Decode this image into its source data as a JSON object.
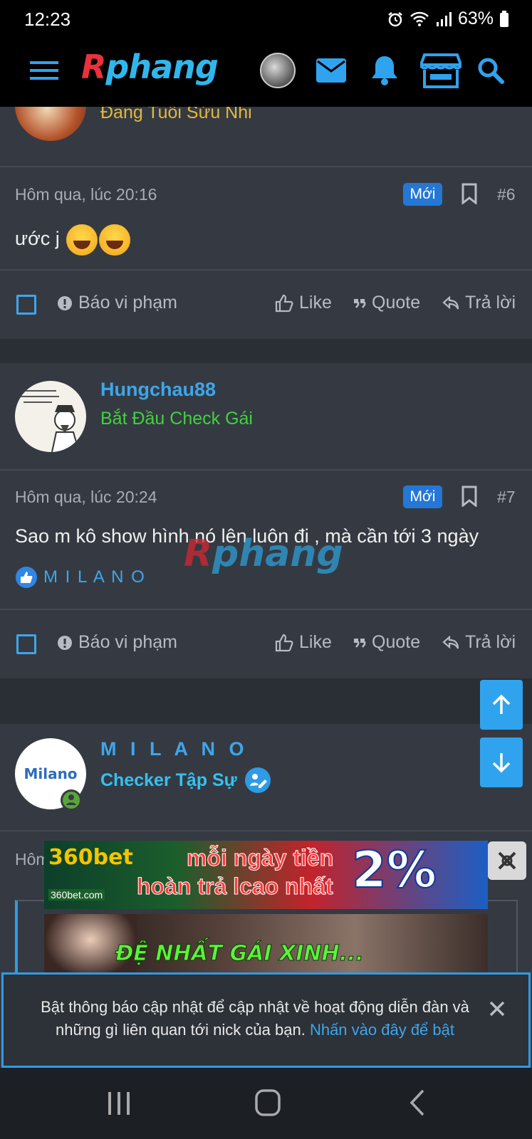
{
  "status": {
    "time": "12:23",
    "battery": "63%"
  },
  "header": {
    "logo_part1": "R",
    "logo_part2": "phang",
    "icons": [
      "menu-icon",
      "avatar",
      "mail-icon",
      "bell-icon",
      "store-icon",
      "search-icon"
    ]
  },
  "post5": {
    "usertitle": "Đang Tuổi Sửu Nhi"
  },
  "post6": {
    "time": "Hôm qua, lúc 20:16",
    "badge": "Mới",
    "number": "#6",
    "text": "ước j"
  },
  "actions": {
    "report": "Báo vi phạm",
    "like": "Like",
    "quote": "Quote",
    "reply": "Trả lời"
  },
  "post7": {
    "username": "Hungchau88",
    "usertitle": "Bắt Đầu Check Gái",
    "time": "Hôm qua, lúc 20:24",
    "badge": "Mới",
    "number": "#7",
    "text": "Sao m kô show hình nó lên luôn đi , mà cần tới 3 ngày",
    "reaction_user": "M I L A N O"
  },
  "post8": {
    "username": "M I L A N O",
    "usertitle": "Checker Tập Sự",
    "avatar_text": "Milano",
    "time_partial": "Hôm"
  },
  "ads": {
    "ad1_brand": "360bet",
    "ad1_domain": "360bet.com",
    "ad1_line1": "mỗi ngày tiền",
    "ad1_line2": "hoàn trả lcao nhất",
    "ad1_percent": "2%",
    "ad2_text": "ĐỆ NHẤT GÁI XINH..."
  },
  "notice": {
    "text": "Bật thông báo cập nhật để cập nhật về hoạt động diễn đàn và những gì liên quan tới nick của bạn.",
    "link": "Nhấn vào đây để bật"
  },
  "watermark": {
    "part1": "R",
    "part2": "phang"
  },
  "colors": {
    "accent": "#3ea6ea",
    "badge": "#2577d6",
    "title_gold": "#e3b83a",
    "title_green": "#3fd23f",
    "title_cyan": "#36c0f0"
  }
}
